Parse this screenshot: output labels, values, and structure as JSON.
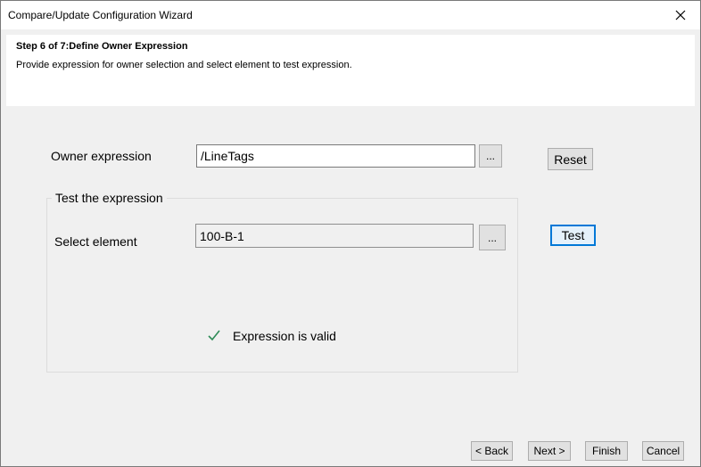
{
  "window": {
    "title": "Compare/Update Configuration Wizard"
  },
  "header": {
    "step_title": "Step 6 of 7:Define Owner Expression",
    "step_description": "Provide expression for owner selection and select element to test expression."
  },
  "owner": {
    "label": "Owner expression",
    "value": "/LineTags",
    "browse_label": "...",
    "reset_label": "Reset"
  },
  "test": {
    "group_label": "Test the expression",
    "select_label": "Select element",
    "element_value": "100-B-1",
    "browse_label": "...",
    "test_label": "Test",
    "status_text": "Expression is valid",
    "status_color": "#2e8b57"
  },
  "footer": {
    "back_label": "< Back",
    "next_label": "Next >",
    "finish_label": "Finish",
    "cancel_label": "Cancel"
  },
  "icons": {
    "close": "close-icon",
    "status": "checkmark-icon"
  }
}
